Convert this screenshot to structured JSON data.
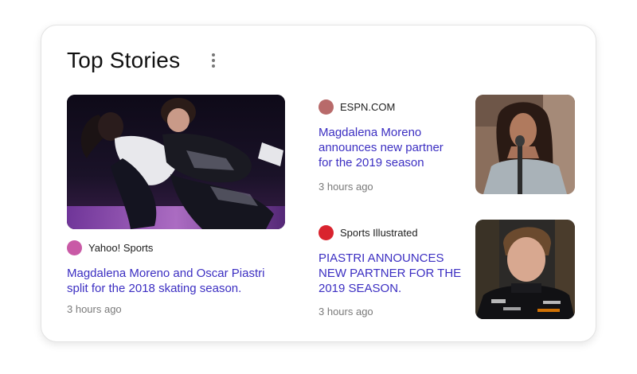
{
  "section": {
    "title": "Top Stories"
  },
  "stories": [
    {
      "source": "Yahoo! Sports",
      "source_color": "#c95aa6",
      "headline": "Magdalena Moreno and Oscar Piastri split for the 2018 skating season.",
      "time": "3 hours ago",
      "image": "ice-skating-pair-photo"
    },
    {
      "source": "ESPN.COM",
      "source_color": "#b86a6a",
      "headline": "Magdalena Moreno announces new partner for the 2019 season",
      "time": "3 hours ago",
      "image": "woman-at-microphone-photo"
    },
    {
      "source": "Sports Illustrated",
      "source_color": "#d9232e",
      "headline": "PIASTRI ANNOUNCES NEW PARTNER FOR THE 2019 SEASON.",
      "time": "3 hours ago",
      "image": "driver-portrait-photo"
    }
  ],
  "colors": {
    "headline": "#3c2fc2",
    "meta": "#7a7a7a"
  }
}
